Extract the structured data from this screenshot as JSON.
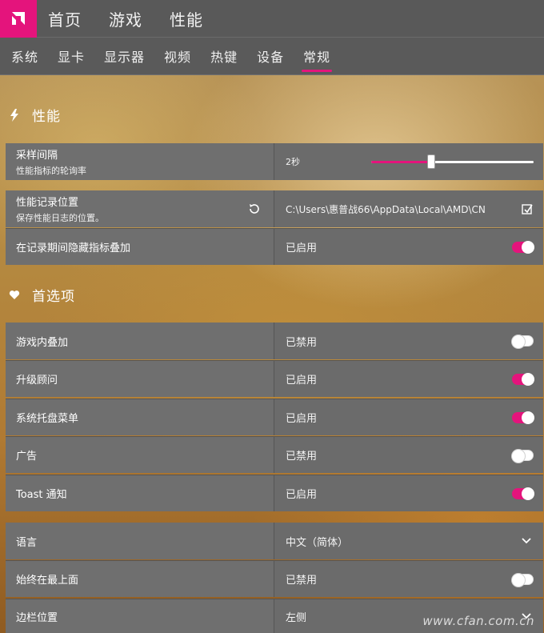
{
  "top_nav": [
    "首页",
    "游戏",
    "性能"
  ],
  "sub_nav": {
    "tabs": [
      "系统",
      "显卡",
      "显示器",
      "视频",
      "热键",
      "设备",
      "常规"
    ],
    "active": "常规"
  },
  "colors": {
    "accent": "#e4147c",
    "bar": "#595959",
    "row": "#6f6f6f"
  },
  "performance": {
    "heading": "性能",
    "icon": "lightning-icon",
    "sampling": {
      "label": "采样间隔",
      "sub": "性能指标的轮询率",
      "value": "2秒",
      "slider_fraction": 0.37
    },
    "log_location": {
      "label": "性能记录位置",
      "sub": "保存性能日志的位置。",
      "path": "C:\\Users\\惠普战66\\AppData\\Local\\AMD\\CN"
    },
    "hide_overlay": {
      "label": "在记录期间隐藏指标叠加",
      "status": "已启用",
      "on": true
    }
  },
  "preferences": {
    "heading": "首选项",
    "icon": "heart-icon",
    "items": [
      {
        "label": "游戏内叠加",
        "status": "已禁用",
        "on": false
      },
      {
        "label": "升级顾问",
        "status": "已启用",
        "on": true
      },
      {
        "label": "系统托盘菜单",
        "status": "已启用",
        "on": true
      },
      {
        "label": "广告",
        "status": "已禁用",
        "on": false
      },
      {
        "label": "Toast 通知",
        "status": "已启用",
        "on": true
      }
    ]
  },
  "general": {
    "language": {
      "label": "语言",
      "value": "中文（简体）"
    },
    "always_on_top": {
      "label": "始终在最上面",
      "status": "已禁用",
      "on": false
    },
    "sidebar_position": {
      "label": "边栏位置",
      "value": "左侧"
    }
  },
  "watermark": "www.cfan.com.cn"
}
